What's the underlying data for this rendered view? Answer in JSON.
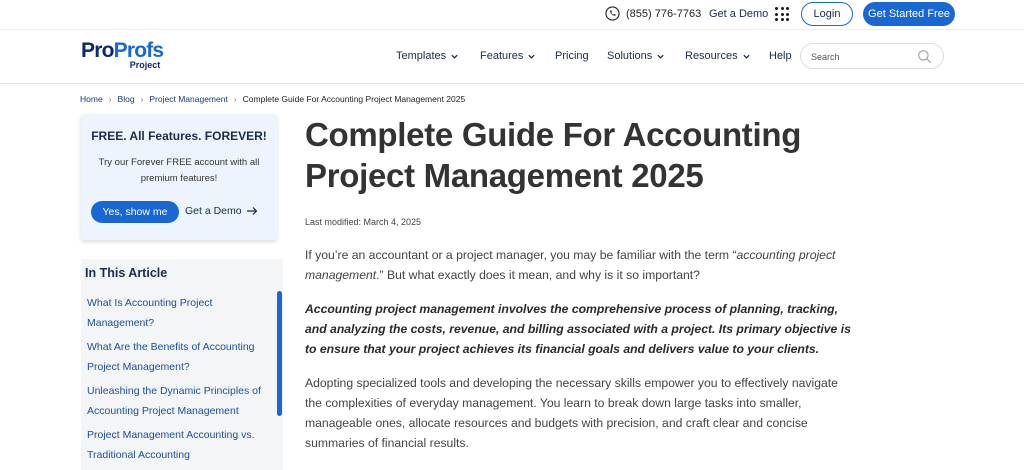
{
  "topbar": {
    "phone": "(855) 776-7763",
    "get_demo": "Get a Demo",
    "login": "Login",
    "get_started": "Get Started Free"
  },
  "header": {
    "logo": {
      "pro": "Pro",
      "profs": "Profs",
      "product": "Project"
    },
    "nav": {
      "templates": "Templates",
      "features": "Features",
      "pricing": "Pricing",
      "solutions": "Solutions",
      "resources": "Resources",
      "help": "Help"
    },
    "search": {
      "placeholder": "Search",
      "value": ""
    }
  },
  "breadcrumb": [
    "Home",
    "Blog",
    "Project Management",
    "Complete Guide For Accounting Project Management 2025"
  ],
  "promo": {
    "title": "FREE. All Features. FOREVER!",
    "text": "Try our Forever FREE account with all premium features!",
    "primary_button": "Yes, show me",
    "secondary_link": "Get a Demo"
  },
  "toc": {
    "title": "In This Article",
    "items": [
      "What Is Accounting Project Management?",
      "What Are the Benefits of Accounting Project Management?",
      "Unleashing the Dynamic Principles of Accounting Project Management",
      "Project Management Accounting vs. Traditional Accounting"
    ]
  },
  "article": {
    "title": "Complete Guide For Accounting Project Management 2025",
    "last_modified": "Last modified: March 4, 2025",
    "p1": {
      "before": "If you’re an accountant or a project manager, you may be familiar with the term “",
      "emph": "accounting project management",
      "after": ".” But what exactly does it mean, and why is it so important?"
    },
    "p2": "Accounting project management involves the comprehensive process of planning, tracking, and analyzing the costs, revenue, and billing associated with a project. Its primary objective is to ensure that your project achieves its financial goals and delivers value to your clients.",
    "p3": "Adopting specialized tools and developing the necessary skills empower you to effectively navigate the complexities of everyday management. You learn to break down large tasks into smaller, manageable ones, allocate resources and budgets with precision, and craft clear and concise summaries of financial results."
  },
  "colors": {
    "accent": "#1967d2",
    "navy": "#1a2b4c",
    "promo_bg": "#edf4fd",
    "toc_bg": "#f4f5f7"
  }
}
